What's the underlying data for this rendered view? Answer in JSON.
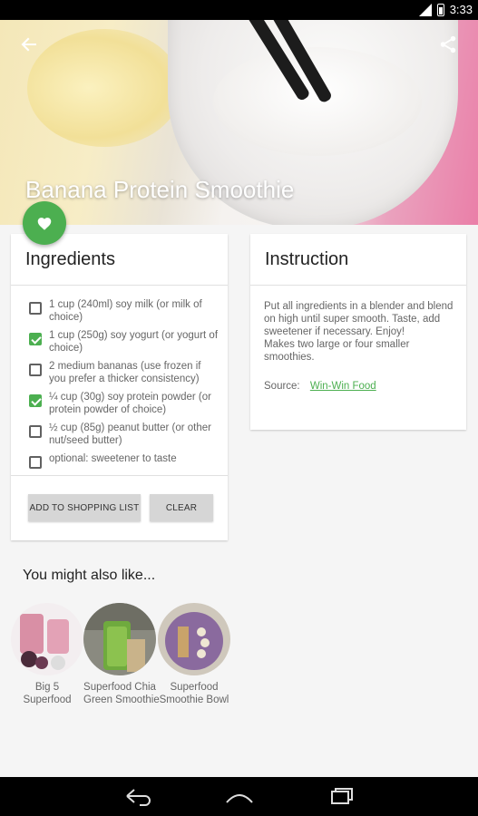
{
  "status_bar": {
    "time": "3:33"
  },
  "hero": {
    "title": "Banana Protein Smoothie",
    "back_icon": "arrow-back-icon",
    "share_icon": "share-icon"
  },
  "fab": {
    "icon": "heart-icon",
    "color": "#4caf50"
  },
  "ingredients": {
    "heading": "Ingredients",
    "items": [
      {
        "text": "1 cup (240ml) soy milk (or milk of choice)",
        "checked": false
      },
      {
        "text": "1 cup (250g) soy yogurt (or yogurt of choice)",
        "checked": true
      },
      {
        "text": "2 medium bananas (use frozen if you prefer a thicker consistency)",
        "checked": false
      },
      {
        "text": "¼ cup (30g) soy protein powder (or protein powder of choice)",
        "checked": true
      },
      {
        "text": "½ cup (85g) peanut butter (or other nut/seed butter)",
        "checked": false
      },
      {
        "text": "optional: sweetener to taste",
        "checked": false
      }
    ],
    "add_button": "ADD TO SHOPPING LIST",
    "clear_button": "CLEAR"
  },
  "instruction": {
    "heading": "Instruction",
    "lines": [
      "Put all ingredients in a blender and blend on high until super smooth. Taste, add sweetener if necessary. Enjoy!",
      "Makes two large or four smaller smoothies."
    ],
    "source_label": "Source:",
    "source_link": "Win-Win Food"
  },
  "also_like": {
    "title": "You might also like...",
    "items": [
      {
        "line1": "Big 5",
        "line2": "Superfood"
      },
      {
        "line1": "Superfood Chia",
        "line2": "Green Smoothie"
      },
      {
        "line1": "Superfood",
        "line2": "Smoothie Bowl"
      }
    ]
  },
  "accent_color": "#4caf50"
}
